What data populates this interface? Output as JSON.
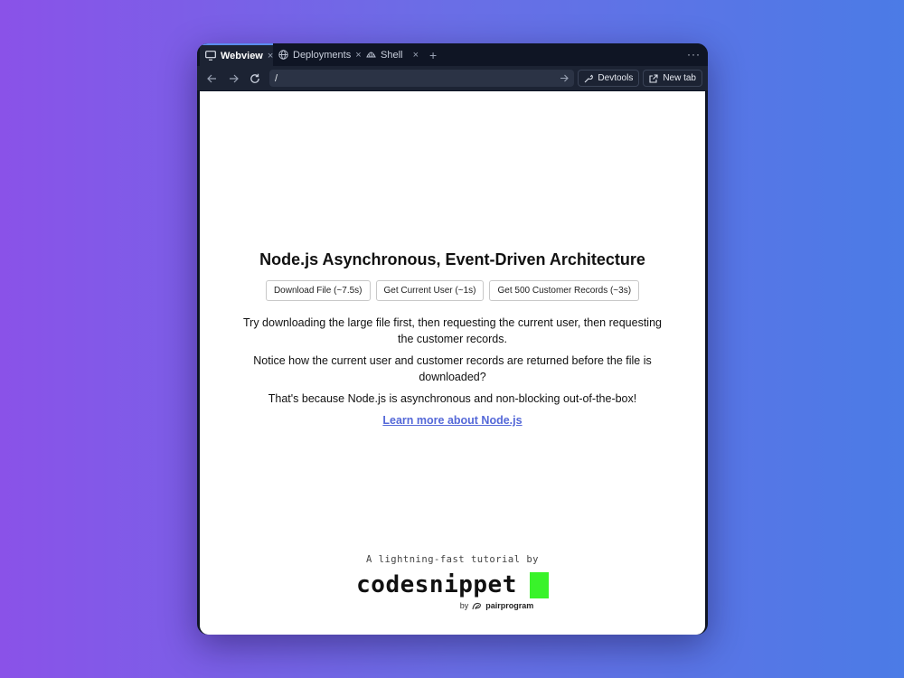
{
  "tabs": [
    {
      "label": "Webview",
      "icon": "monitor-icon",
      "active": true
    },
    {
      "label": "Deployments",
      "icon": "globe-icon",
      "active": false
    },
    {
      "label": "Shell",
      "icon": "shell-icon",
      "active": false
    }
  ],
  "tab_close_glyph": "×",
  "add_tab_glyph": "+",
  "menu_glyph": "···",
  "toolbar": {
    "url": "/",
    "devtools_label": "Devtools",
    "new_tab_label": "New tab"
  },
  "page": {
    "heading": "Node.js Asynchronous, Event-Driven Architecture",
    "buttons": [
      "Download File (~7.5s)",
      "Get Current User (~1s)",
      "Get 500 Customer Records (~3s)"
    ],
    "paragraphs": [
      "Try downloading the large file first, then requesting the current user, then requesting the customer records.",
      "Notice how the current user and customer records are returned before the file is downloaded?",
      "That's because Node.js is asynchronous and non-blocking out-of-the-box!"
    ],
    "link": "Learn more about Node.js"
  },
  "footer": {
    "tagline": "A lightning-fast tutorial by",
    "logo": "codesnippet",
    "by": "by",
    "brand": "pairprogram"
  },
  "colors": {
    "accent": "#5468d8",
    "cursor_green": "#39f32a",
    "tab_active_border": "#5a8dee"
  }
}
